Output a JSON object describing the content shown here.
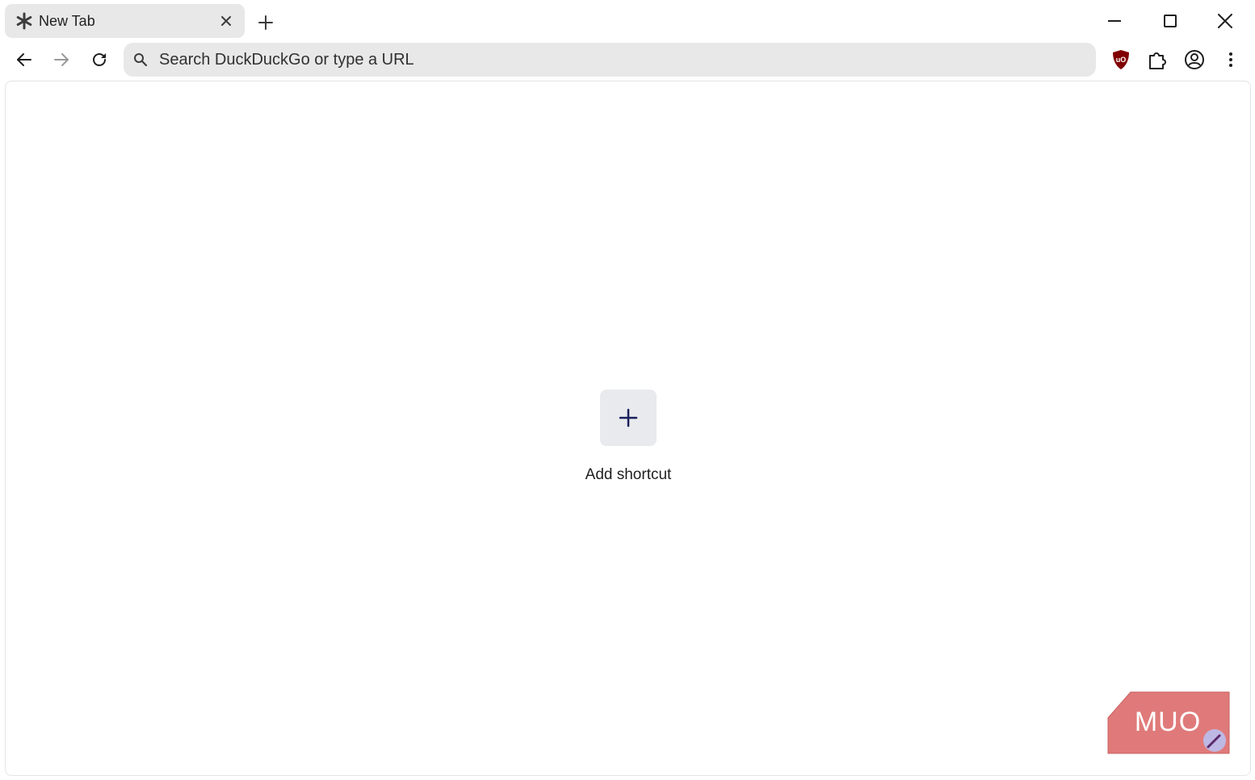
{
  "tab": {
    "title": "New Tab",
    "favicon": "asterisk-icon"
  },
  "omnibox": {
    "placeholder": "Search DuckDuckGo or type a URL",
    "value": ""
  },
  "toolbar": {
    "extensions": [
      "ublock-origin-icon",
      "extensions-puzzle-icon",
      "profile-icon",
      "menu-kebab-icon"
    ]
  },
  "shortcuts": {
    "add_label": "Add shortcut"
  },
  "watermark": {
    "text": "MUO"
  },
  "colors": {
    "tab_bg": "#e8e8e8",
    "omnibox_bg": "#e8e8e8",
    "shortcut_tile_bg": "#e8eaed",
    "plus_color": "#1a1f5c",
    "ublock_red": "#800000",
    "muo_red": "#e07a7a"
  }
}
